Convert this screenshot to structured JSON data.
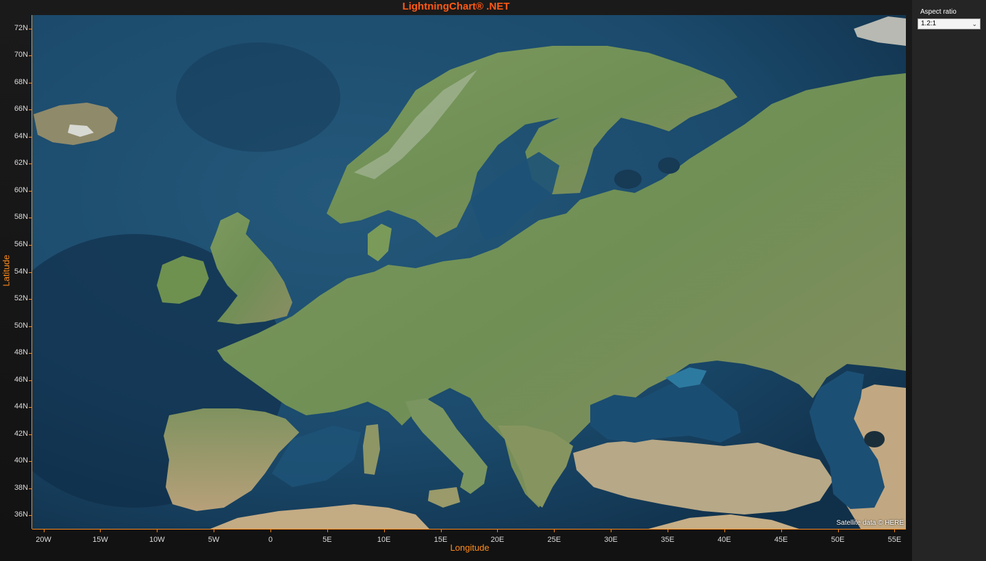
{
  "title": "LightningChart® .NET",
  "axes": {
    "y_title": "Latitude",
    "x_title": "Longitude",
    "y_ticks": [
      "72N",
      "70N",
      "68N",
      "66N",
      "64N",
      "62N",
      "60N",
      "58N",
      "56N",
      "54N",
      "52N",
      "50N",
      "48N",
      "46N",
      "44N",
      "42N",
      "40N",
      "38N",
      "36N"
    ],
    "x_ticks": [
      "20W",
      "15W",
      "10W",
      "5W",
      "0",
      "5E",
      "10E",
      "15E",
      "20E",
      "25E",
      "30E",
      "35E",
      "40E",
      "45E",
      "50E",
      "55E"
    ],
    "lat_range": [
      35,
      73
    ],
    "lon_range": [
      -21,
      56
    ]
  },
  "map": {
    "region": "Europe",
    "style": "satellite",
    "attribution": "Satellite data © HERE"
  },
  "panel": {
    "aspect_label": "Aspect ratio",
    "aspect_value": "1.2:1"
  },
  "colors": {
    "title": "#ff5a14",
    "axis": "#ff8c1a",
    "sea": "#1b4a6c",
    "land": "#6f8f55"
  }
}
